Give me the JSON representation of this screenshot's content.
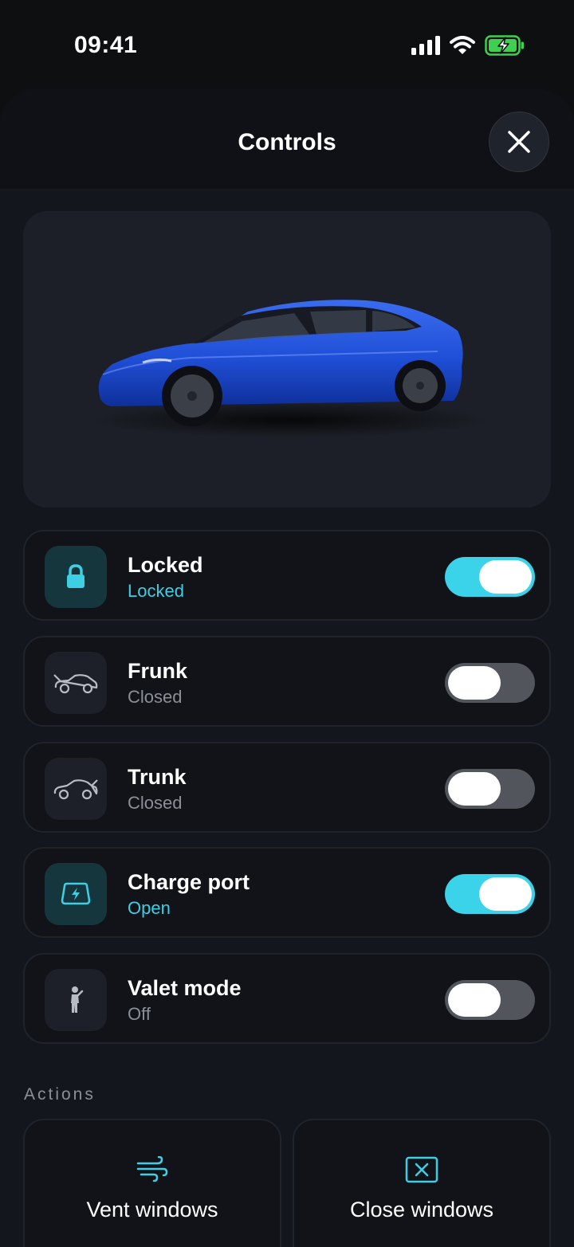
{
  "status_bar": {
    "time": "09:41"
  },
  "header": {
    "title": "Controls"
  },
  "colors": {
    "accent": "#3ad3ea",
    "toggle_off": "#52555c",
    "car_paint": "#1f4fd6"
  },
  "car": {
    "icon": "car-illustration"
  },
  "controls": [
    {
      "title": "Locked",
      "subtitle": "Locked",
      "on": true,
      "icon": "lock-icon"
    },
    {
      "title": "Frunk",
      "subtitle": "Closed",
      "on": false,
      "icon": "frunk-icon"
    },
    {
      "title": "Trunk",
      "subtitle": "Closed",
      "on": false,
      "icon": "trunk-icon"
    },
    {
      "title": "Charge port",
      "subtitle": "Open",
      "on": true,
      "icon": "charge-port-icon"
    },
    {
      "title": "Valet mode",
      "subtitle": "Off",
      "on": false,
      "icon": "valet-person-icon"
    }
  ],
  "actions": {
    "section_label": "Actions",
    "items": [
      {
        "label": "Vent windows",
        "icon": "wind-icon"
      },
      {
        "label": "Close windows",
        "icon": "close-window-icon"
      }
    ]
  }
}
